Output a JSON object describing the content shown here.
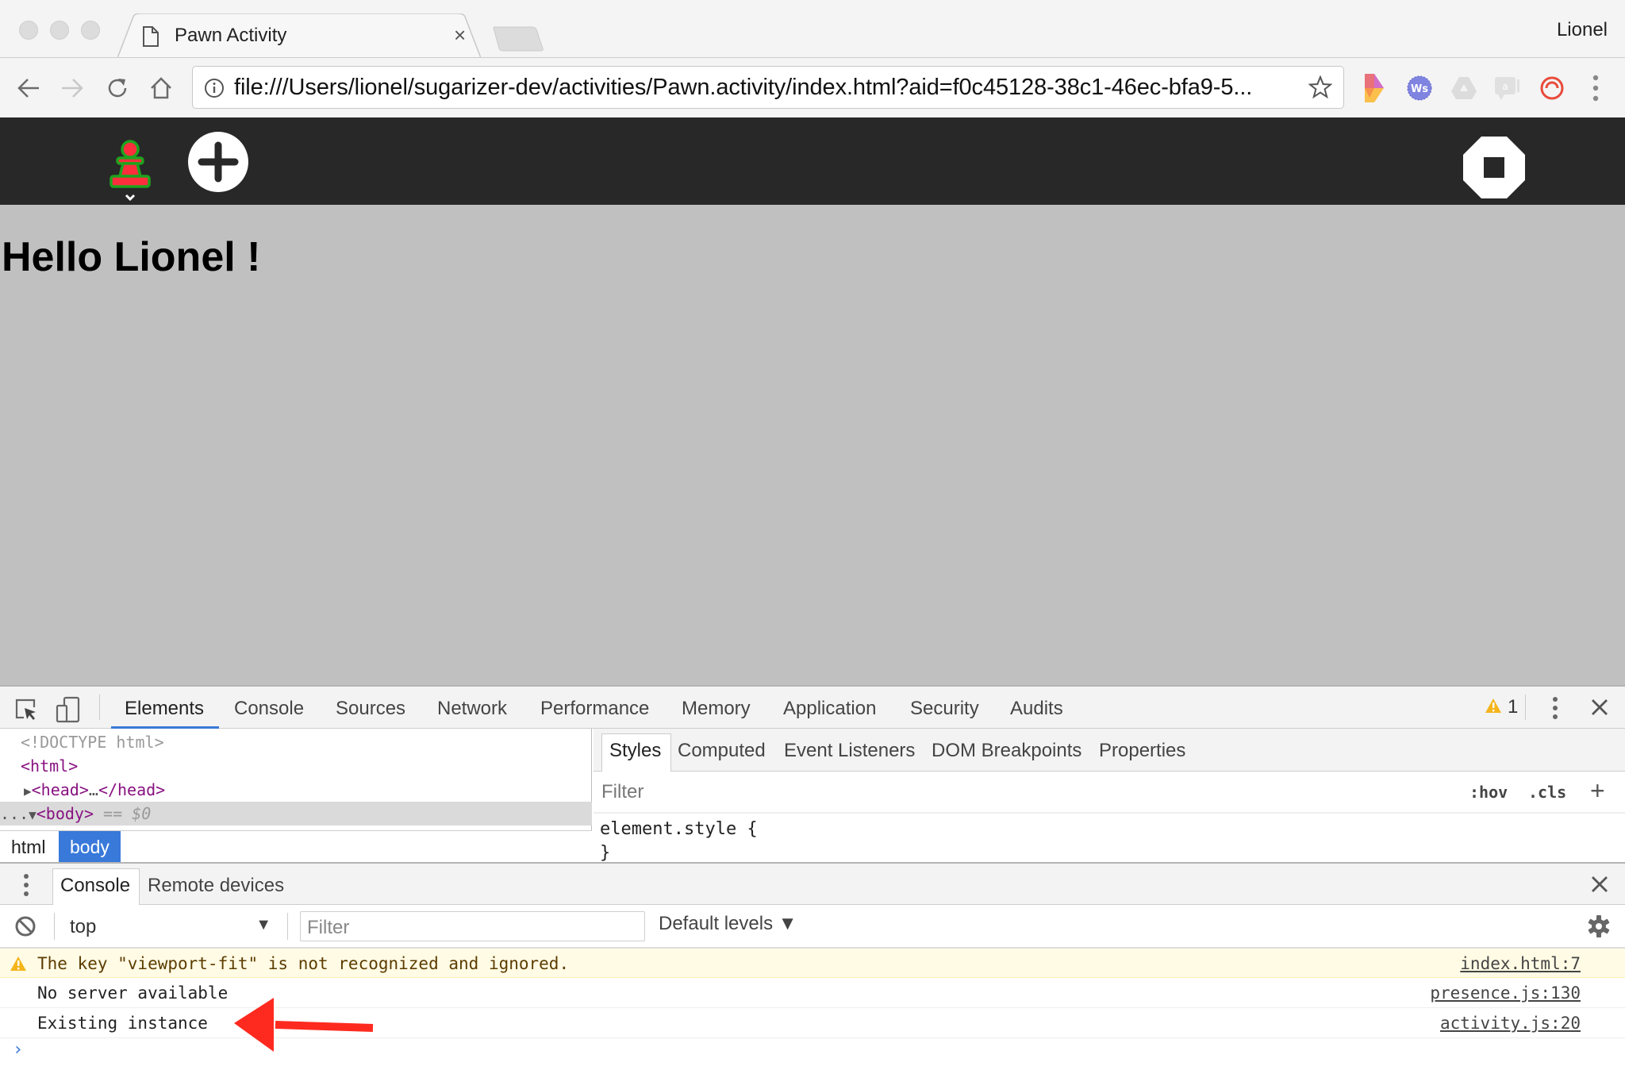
{
  "browser": {
    "tab_title": "Pawn Activity",
    "tab_close": "×",
    "profile_name": "Lionel",
    "url": "file:///Users/lionel/sugarizer-dev/activities/Pawn.activity/index.html?aid=f0c45128-38c1-46ec-bfa9-5...",
    "icons": [
      "back-icon",
      "forward-icon",
      "reload-icon",
      "home-icon",
      "info-icon",
      "bookmark-star-icon",
      "more-vert-icon"
    ],
    "extensions": [
      "colorful-d-extension",
      "ws-extension",
      "drive-extension",
      "chat-extension",
      "spiral-extension"
    ]
  },
  "activity": {
    "toolbar": {
      "icons": [
        "pawn-activity-icon",
        "add-pawn-icon",
        "stop-icon"
      ],
      "accent_colors": {
        "pawn_fill": "#ff2e3d",
        "pawn_stroke": "#1ea31e",
        "toolbar_bg": "#282828"
      }
    },
    "greeting": "Hello Lionel !"
  },
  "devtools": {
    "tabs": [
      "Elements",
      "Console",
      "Sources",
      "Network",
      "Performance",
      "Memory",
      "Application",
      "Security",
      "Audits"
    ],
    "active_tab": "Elements",
    "warning_count": "1",
    "dom": {
      "doctype": "<!DOCTYPE html>",
      "html_open": "<html>",
      "head": {
        "open": "<head>",
        "ellipsis": "…",
        "close": "</head>"
      },
      "body": {
        "prefix": "...",
        "open": "<body>",
        "eq": " == ",
        "ref": "$0"
      }
    },
    "breadcrumbs": [
      "html",
      "body"
    ],
    "styles_tabs": [
      "Styles",
      "Computed",
      "Event Listeners",
      "DOM Breakpoints",
      "Properties"
    ],
    "styles_filter_placeholder": "Filter",
    "hov_label": ":hov",
    "cls_label": ".cls",
    "add_rule": "+",
    "element_style_open": "element.style {",
    "element_style_close": "}"
  },
  "drawer": {
    "tabs": [
      "Console",
      "Remote devices"
    ],
    "active_tab": "Console",
    "context": "top",
    "filter_placeholder": "Filter",
    "levels": "Default levels ▼",
    "messages": [
      {
        "level": "warning",
        "text": "The key \"viewport-fit\" is not recognized and ignored.",
        "source": "index.html:7"
      },
      {
        "level": "log",
        "text": "No server available",
        "source": "presence.js:130"
      },
      {
        "level": "log",
        "text": "Existing instance",
        "source": "activity.js:20"
      }
    ],
    "prompt": "›"
  },
  "annotation": {
    "type": "red-arrow",
    "points_to": "Existing instance",
    "color": "#ff2a1f"
  }
}
